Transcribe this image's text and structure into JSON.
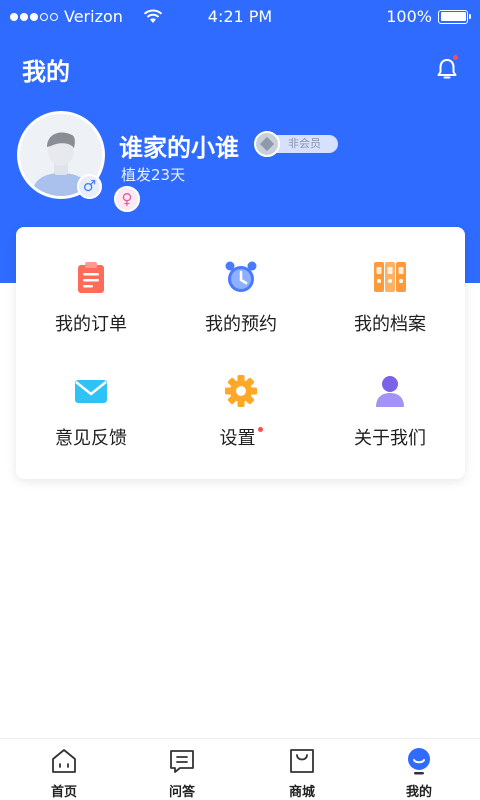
{
  "status_bar": {
    "carrier": "Verizon",
    "time": "4:21 PM",
    "battery": "100%"
  },
  "header": {
    "title": "我的"
  },
  "profile": {
    "username": "谁家的小谁",
    "member_status": "非会员",
    "plant_days": "植发23天"
  },
  "menu": [
    {
      "label": "我的订单",
      "icon": "order-icon",
      "color": "#ff6b5b"
    },
    {
      "label": "我的预约",
      "icon": "alarm-clock-icon",
      "color": "#4a7bff"
    },
    {
      "label": "我的档案",
      "icon": "archive-icon",
      "color": "#ff9a3c"
    },
    {
      "label": "意见反馈",
      "icon": "mail-icon",
      "color": "#2fc3f5"
    },
    {
      "label": "设置",
      "icon": "gear-icon",
      "color": "#ffa726",
      "has_dot": true
    },
    {
      "label": "关于我们",
      "icon": "person-icon",
      "color": "#7a63e8"
    }
  ],
  "tabbar": [
    {
      "label": "首页",
      "icon": "home-icon"
    },
    {
      "label": "问答",
      "icon": "qa-icon"
    },
    {
      "label": "商城",
      "icon": "shopping-bag-icon"
    },
    {
      "label": "我的",
      "icon": "profile-tab-icon",
      "active": true
    }
  ],
  "colors": {
    "primary": "#2f6bff",
    "badge_red": "#ff4d4f"
  }
}
